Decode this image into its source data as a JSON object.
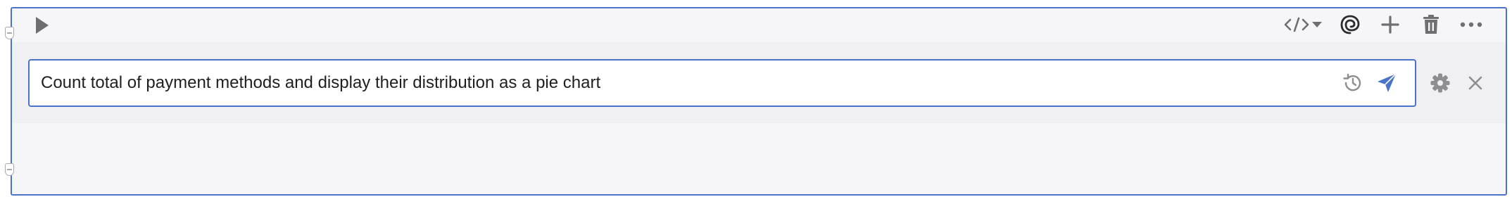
{
  "cell": {
    "prompt": {
      "value": "Count total of payment methods and display their distribution as a pie chart"
    },
    "toolbar": {
      "icons": [
        "code-toggle-icon",
        "chevron-down-icon",
        "ai-assistant-icon",
        "plus-icon",
        "trash-icon",
        "more-icon"
      ]
    },
    "prompt_icons": [
      "history-icon",
      "send-icon",
      "gear-icon",
      "close-icon"
    ],
    "colors": {
      "accent": "#4a74c9",
      "icon": "#6e6e73",
      "background": "#f6f6f8"
    }
  }
}
